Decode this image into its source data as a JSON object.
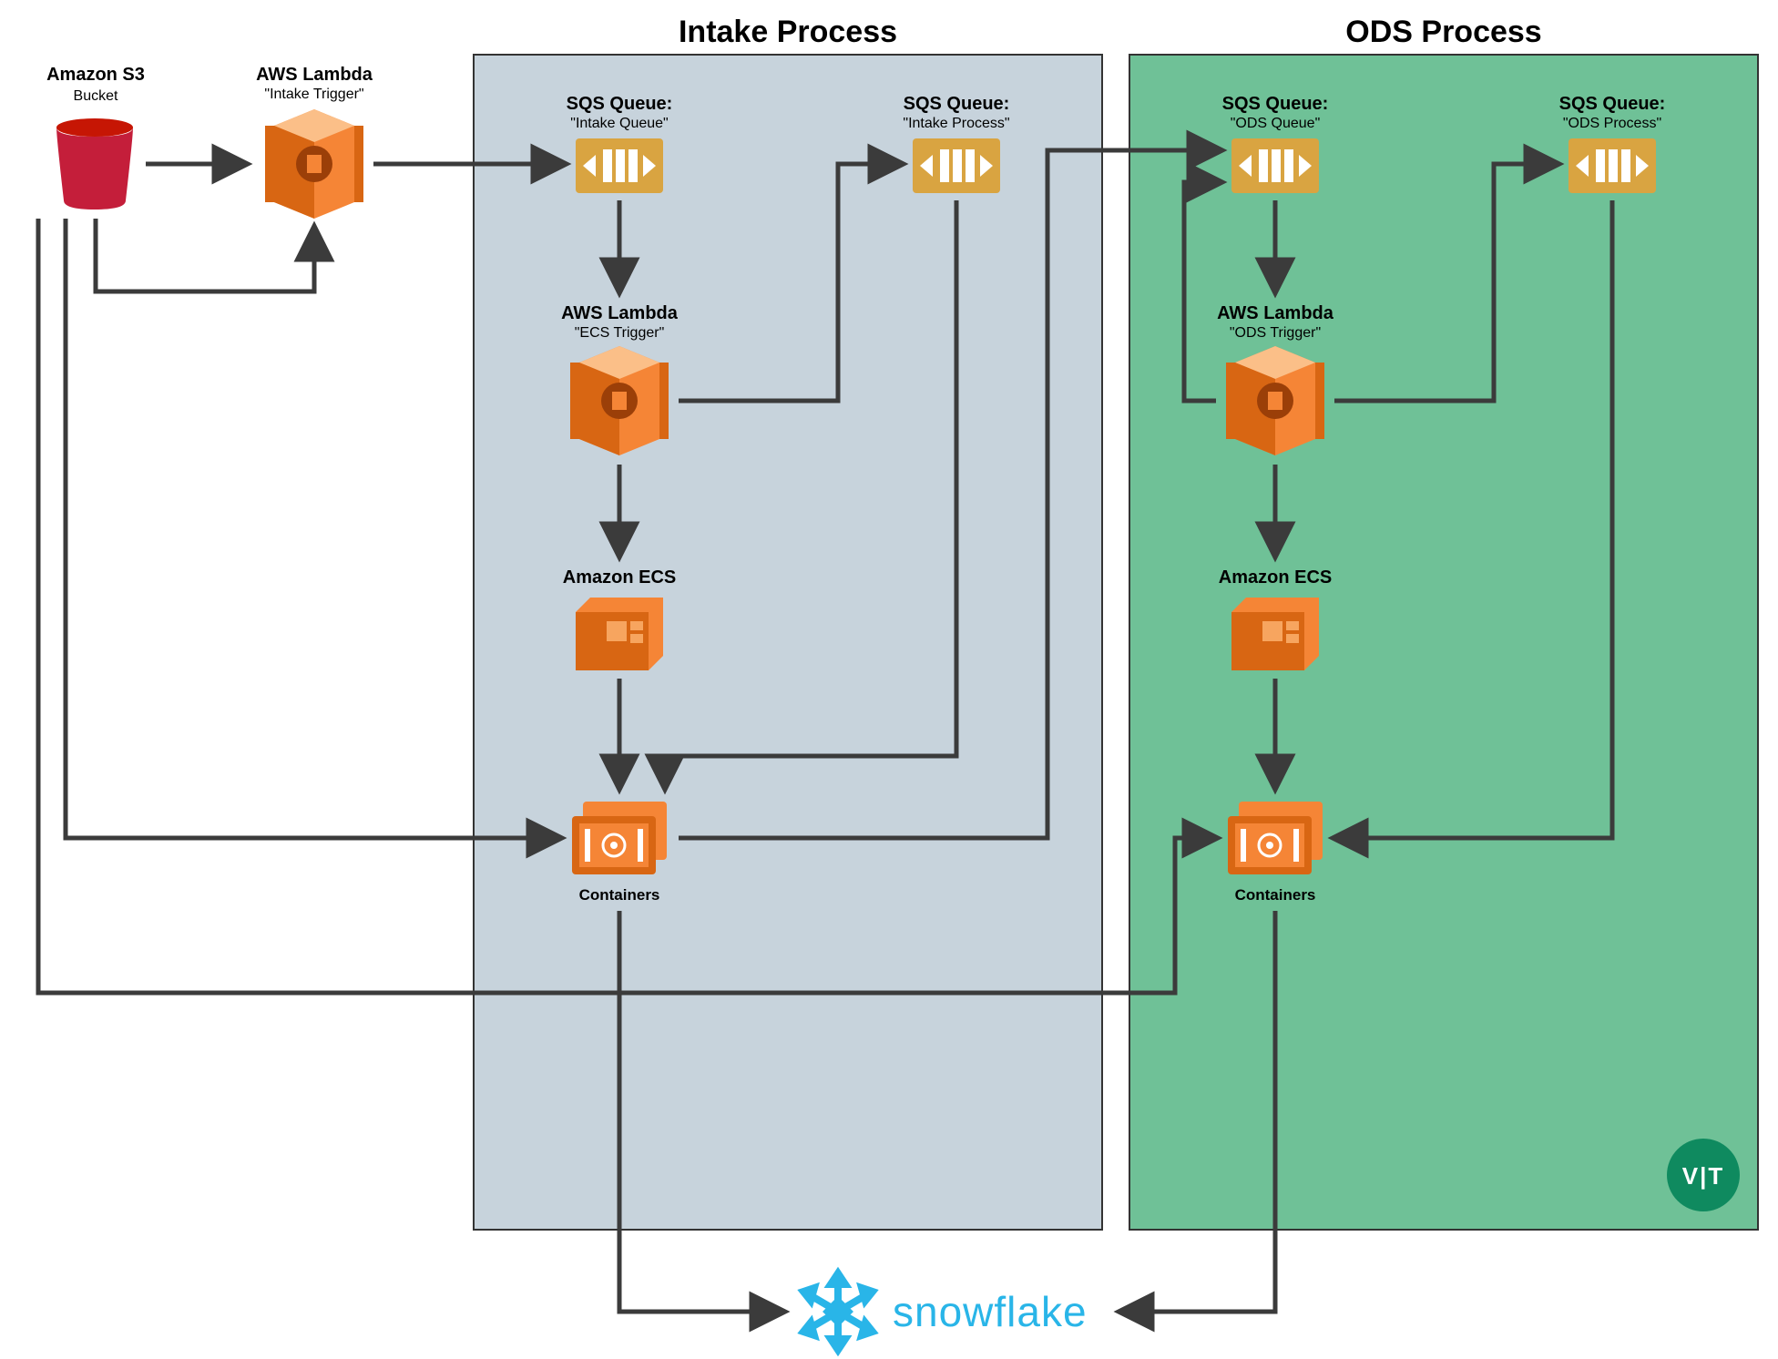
{
  "titles": {
    "intake": "Intake Process",
    "ods": "ODS Process"
  },
  "nodes": {
    "s3": {
      "t1": "Amazon S3",
      "t2": "Bucket"
    },
    "lam0": {
      "t1": "AWS Lambda",
      "t2": "\"Intake Trigger\""
    },
    "sqs_iq": {
      "t1": "SQS Queue:",
      "t2": "\"Intake Queue\""
    },
    "sqs_ip": {
      "t1": "SQS Queue:",
      "t2": "\"Intake Process\""
    },
    "lam1": {
      "t1": "AWS Lambda",
      "t2": "\"ECS Trigger\""
    },
    "ecs1": {
      "t1": "Amazon ECS"
    },
    "cont1": {
      "t1": "Containers"
    },
    "sqs_oq": {
      "t1": "SQS Queue:",
      "t2": "\"ODS Queue\""
    },
    "sqs_op": {
      "t1": "SQS Queue:",
      "t2": "\"ODS Process\""
    },
    "lam2": {
      "t1": "AWS Lambda",
      "t2": "\"ODS Trigger\""
    },
    "ecs2": {
      "t1": "Amazon ECS"
    },
    "cont2": {
      "t1": "Containers"
    },
    "snow": {
      "t1": "snowflake"
    },
    "badge": {
      "t1": "V|T"
    }
  }
}
